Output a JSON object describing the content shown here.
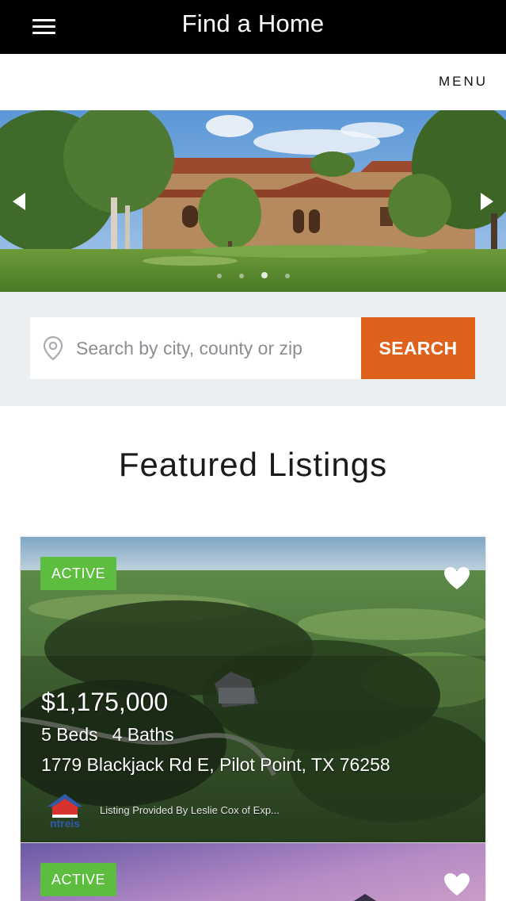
{
  "app": {
    "title": "Find a Home"
  },
  "header": {
    "menu_label": "MENU"
  },
  "carousel": {
    "slide_count": 4,
    "active_index": 3
  },
  "search": {
    "placeholder": "Search by city, county or zip",
    "value": "",
    "button_label": "SEARCH"
  },
  "featured": {
    "heading": "Featured Listings",
    "listings": [
      {
        "status": "ACTIVE",
        "price": "$1,175,000",
        "beds": "5 Beds",
        "baths": "4 Baths",
        "address": "1779 Blackjack Rd E, Pilot Point, TX 76258",
        "provider": "Listing Provided By Leslie Cox of Exp...",
        "logo_text": "ntreis"
      },
      {
        "status": "ACTIVE"
      }
    ]
  },
  "colors": {
    "appbar": "#000000",
    "search_button": "#df621c",
    "active_badge": "#5cbd3f",
    "search_area_bg": "#ebeff1"
  },
  "icons": {
    "menu": "hamburger-icon",
    "location": "location-pin-icon",
    "favorite": "heart-icon",
    "prev": "chevron-left-icon",
    "next": "chevron-right-icon"
  }
}
